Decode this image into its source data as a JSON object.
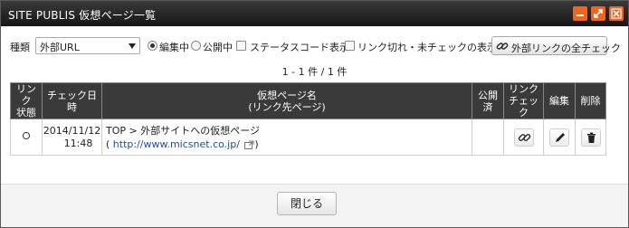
{
  "window": {
    "title": "SITE PUBLIS 仮想ページ一覧"
  },
  "filter": {
    "type_label": "種類",
    "type_value": "外部URL",
    "radio_editing": "編集中",
    "radio_published": "公開中",
    "check_status_code": "ステータスコード表示",
    "check_broken": "リンク切れ・未チェックの表示",
    "external_check_button": "外部リンクの全チェック"
  },
  "pagination": {
    "count_text": "1 - 1 件 / 1 件"
  },
  "table": {
    "headers": {
      "link_status": [
        "リンク",
        "状態"
      ],
      "check_date": "チェック日時",
      "page_name": [
        "仮想ページ名",
        "(リンク先ページ)"
      ],
      "published": "公開済",
      "link_check": [
        "リンク",
        "チェック"
      ],
      "edit": "編集",
      "delete": "削除"
    },
    "rows": [
      {
        "status_icon": "circle-outline-icon",
        "date": "2014/11/12",
        "time": "11:48",
        "name": "TOP > 外部サイトへの仮想ページ",
        "url_prefix": "(",
        "url": "http://www.micsnet.co.jp/",
        "url_suffix": ")",
        "published": ""
      }
    ]
  },
  "footer": {
    "close_label": "閉じる"
  },
  "colors": {
    "titlebar": "#1e1e1e",
    "accent": "#f0641e",
    "link": "#1a4f9a"
  }
}
